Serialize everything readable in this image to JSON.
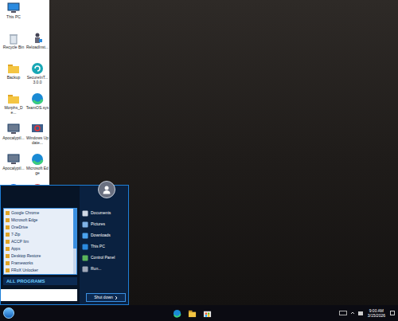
{
  "desktop": {
    "icon_rows": [
      [
        {
          "label": "This PC",
          "kind": "pc"
        }
      ],
      [
        {
          "label": "Recycle Bin",
          "kind": "bin"
        },
        {
          "label": "ReloadInst...",
          "kind": "tool"
        }
      ],
      [
        {
          "label": "Backup",
          "kind": "folder"
        },
        {
          "label": "SecureInT... 3.0.0",
          "kind": "teal"
        }
      ],
      [
        {
          "label": "Morphs_De...",
          "kind": "folder"
        },
        {
          "label": "TeamOS.sys",
          "kind": "edge"
        }
      ],
      [
        {
          "label": "ApocalyptI...",
          "kind": "window"
        },
        {
          "label": "Windows Update...",
          "kind": "gear"
        }
      ],
      [
        {
          "label": "ApocalyptI...",
          "kind": "window"
        },
        {
          "label": "Microsoft Edge",
          "kind": "edge"
        }
      ],
      [
        {
          "label": "",
          "kind": "blue"
        },
        {
          "label": "",
          "kind": "chrome"
        }
      ]
    ]
  },
  "start_menu": {
    "programs": [
      "Google Chrome",
      "Microsoft Edge",
      "OneDrive",
      "7-Zip",
      "ACCP Itm",
      "Apps",
      "Desktop Restore",
      "Frameworks",
      "FRoX Unlocker"
    ],
    "all_programs": "ALL PROGRAMS",
    "places": [
      {
        "label": "Documents",
        "kind": "documents"
      },
      {
        "label": "Pictures",
        "kind": "pictures"
      },
      {
        "label": "Downloads",
        "kind": "downloads"
      },
      {
        "label": "This PC",
        "kind": "pc"
      },
      {
        "label": "Control Panel",
        "kind": "control"
      },
      {
        "label": "Run...",
        "kind": "run"
      }
    ],
    "shutdown": "Shut down"
  },
  "taskbar": {
    "pinned": [
      {
        "kind": "edge"
      },
      {
        "kind": "folder"
      },
      {
        "kind": "store"
      }
    ],
    "clock": {
      "time": "9:00 AM",
      "date": "3/15/2026"
    }
  }
}
